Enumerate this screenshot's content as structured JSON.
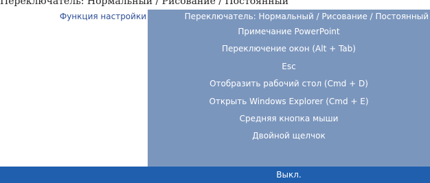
{
  "header": {
    "cut_text": "Переключатель: Нормальный / Рисование / Постоянный"
  },
  "function_label": "Функция настройки",
  "menu": {
    "items": [
      "Переключатель: Нормальный / Рисование / Постоянный",
      "Примечание PowerPoint",
      "Переключение окон (Alt + Tab)",
      "Esc",
      "Отобразить рабочий стол (Cmd + D)",
      "Открыть Windows Explorer (Cmd + E)",
      "Средняя кнопка мыши",
      "Двойной щелчок"
    ],
    "selected": "Выкл."
  },
  "colors": {
    "menu_bg": "#7b96bd",
    "selected_bg": "#1f5fae",
    "label_color": "#2d4f98"
  }
}
